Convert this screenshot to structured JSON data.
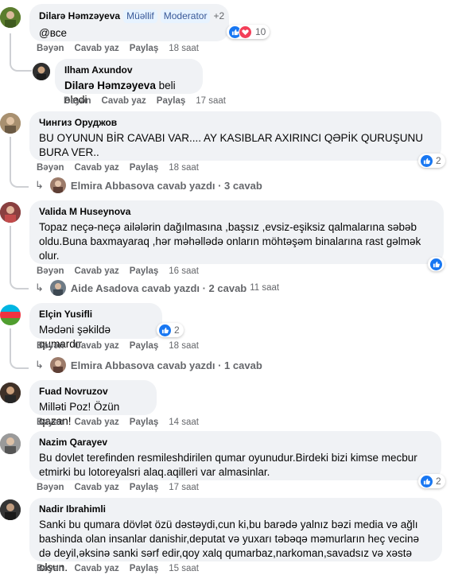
{
  "actions": {
    "like": "Bəyən",
    "reply": "Cavab yaz",
    "share": "Paylaş"
  },
  "comments": [
    {
      "author": "Dilarə Həmzəyeva",
      "badges": [
        "Müəllif",
        "Moderator"
      ],
      "badge_extra": "+2",
      "text": "@все",
      "time": "18 saat",
      "reactions": "10"
    },
    {
      "author": "Ilham Axundov",
      "mention": "Dilarə Həmzəyeva",
      "text": "beli eledi",
      "time": "17 saat"
    },
    {
      "author": "Чингиз Оруджов",
      "text": "BU OYUNUN BİR CAVABI VAR.... AY KASIBLAR AXIRINCI QƏPİK QURUŞUNU BURA VER..",
      "time": "18 saat",
      "reactions": "2",
      "replies": "Elmira Abbasova cavab yazdı · 3 cavab"
    },
    {
      "author": "Valida M Huseynova",
      "text": "Topaz neçə-neçə ailələrin dağılmasına ,başsız ,evsiz-eşiksiz qalmalarına səbəb oldu.Buna baxmayaraq ,hər məhəllədə onların möhtəşəm binalarına rast gəlmək olur.",
      "time": "16 saat",
      "replies": "Aide Asadova cavab yazdı · 2 cavab",
      "replies_time": "11 saat"
    },
    {
      "author": "Elçin Yusifli",
      "text": "Mədəni şəkildə qumardır",
      "time": "18 saat",
      "reactions": "2",
      "replies": "Elmira Abbasova cavab yazdı · 1 cavab"
    },
    {
      "author": "Fuad Novruzov",
      "text": "Milləti Poz! Özün qazan!",
      "time": "14 saat"
    },
    {
      "author": "Nazim Qarayev",
      "text": "Bu dovlet terefinden resmileshdirilen qumar oyunudur.Birdeki bizi kimse mecbur etmirki bu lotoreyalsri alaq.aqilleri var almasinlar.",
      "time": "17 saat",
      "reactions": "2"
    },
    {
      "author": "Nadir Ibrahimli",
      "text": "Sanki bu qumara dövlət özü dəstəydi,cun ki,bu barədə yalnız bəzi media və ağlı bashinda olan insanlar danishir,deputat və yuxarı təbəqə məmurların heç vecinə də deyil,əksinə sanki sərf edir,qoy xalq qumarbaz,narkoman,savadsız və xəstə olsun.",
      "time": "15 saat"
    }
  ],
  "icons": {
    "like": "thumbs-up-icon",
    "love": "heart-icon",
    "reply_arrow": "reply-arrow-icon"
  },
  "colors": {
    "bubble": "#f0f2f5",
    "meta": "#65676b",
    "like": "#1877f2",
    "love": "#f33e58"
  }
}
